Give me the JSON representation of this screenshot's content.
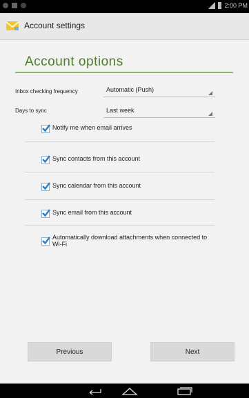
{
  "status_bar": {
    "time": "2:00 PM"
  },
  "action_bar": {
    "title": "Account settings",
    "icon": "email-icon"
  },
  "main": {
    "heading": "Account options",
    "fields": [
      {
        "label": "Inbox checking frequency",
        "value": "Automatic (Push)"
      },
      {
        "label": "Days to sync",
        "value": "Last week"
      }
    ],
    "checkboxes": [
      {
        "label": "Notify me when email arrives",
        "checked": true
      },
      {
        "label": "Sync contacts from this account",
        "checked": true
      },
      {
        "label": "Sync calendar from this account",
        "checked": true
      },
      {
        "label": "Sync email from this account",
        "checked": true
      },
      {
        "label": "Automatically download attachments when connected to Wi-Fi",
        "checked": true
      }
    ]
  },
  "buttons": {
    "previous": "Previous",
    "next": "Next"
  },
  "nav_bar": {
    "icons": [
      "back-icon",
      "home-icon",
      "recents-icon"
    ]
  },
  "colors": {
    "accent": "#4a7d2a",
    "accent_rule": "#8bb56a",
    "check": "#2f7fc1"
  }
}
